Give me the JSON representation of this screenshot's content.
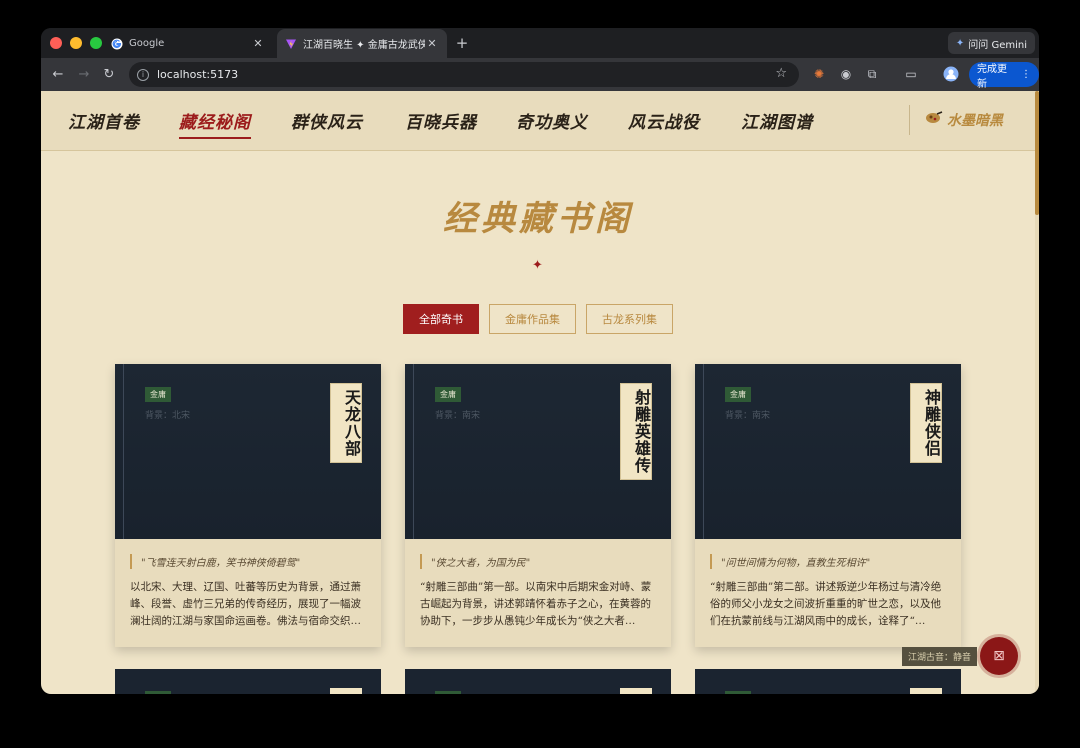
{
  "browser": {
    "tabs": [
      {
        "title": "Google",
        "favicon": "google-icon"
      },
      {
        "title": "江湖百晓生 ✦ 金庸古龙武侠大",
        "favicon": "vite-icon",
        "active": true
      }
    ],
    "gemini_label": "问问 Gemini",
    "url": "localhost:5173",
    "update_label": "完成更新"
  },
  "site": {
    "nav": [
      "江湖首卷",
      "藏经秘阁",
      "群侠风云",
      "百晓兵器",
      "奇功奥义",
      "风云战役",
      "江湖图谱"
    ],
    "active_nav": 1,
    "theme_toggle": "水墨暗黑",
    "section_title": "经典藏书阁",
    "filters": [
      "全部奇书",
      "金庸作品集",
      "古龙系列集"
    ],
    "active_filter": 0,
    "books": [
      {
        "tag": "金庸",
        "setting": "背景：北宋",
        "title": "天龙八部",
        "quote": "\"飞雪连天射白鹿，笑书神侠倚碧鸳\"",
        "desc": "以北宋、大理、辽国、吐蕃等历史为背景，通过萧峰、段誉、虚竹三兄弟的传奇经历，展现了一幅波澜壮阔的江湖与家国命运画卷。佛法与宿命交织…"
      },
      {
        "tag": "金庸",
        "setting": "背景：南宋",
        "title": "射雕英雄传",
        "quote": "\"侠之大者，为国为民\"",
        "desc": "“射雕三部曲”第一部。以南宋中后期宋金对峙、蒙古崛起为背景，讲述郭靖怀着赤子之心，在黄蓉的协助下，一步步从愚钝少年成长为“侠之大者…"
      },
      {
        "tag": "金庸",
        "setting": "背景：南宋",
        "title": "神雕侠侣",
        "quote": "\"问世间情为何物，直教生死相许\"",
        "desc": "“射雕三部曲”第二部。讲述叛逆少年杨过与清冷绝俗的师父小龙女之间波折重重的旷世之恋，以及他们在抗蒙前线与江湖风雨中的成长，诠释了“…"
      }
    ],
    "music_label": "江湖古音：静音"
  }
}
